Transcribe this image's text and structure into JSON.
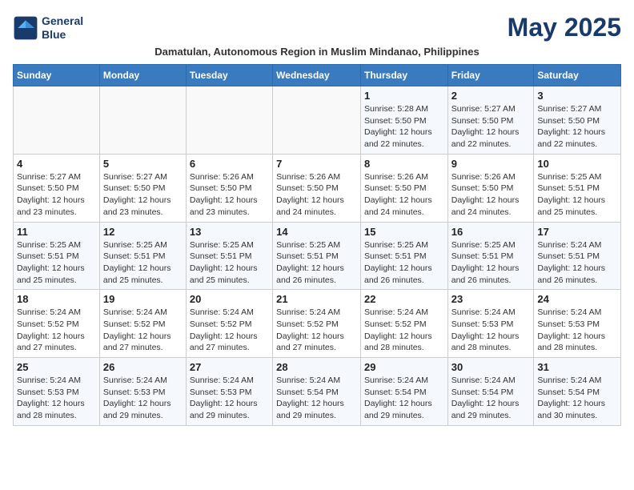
{
  "header": {
    "logo_line1": "General",
    "logo_line2": "Blue",
    "month_title": "May 2025",
    "subtitle": "Damatulan, Autonomous Region in Muslim Mindanao, Philippines"
  },
  "weekdays": [
    "Sunday",
    "Monday",
    "Tuesday",
    "Wednesday",
    "Thursday",
    "Friday",
    "Saturday"
  ],
  "weeks": [
    [
      {
        "day": "",
        "info": ""
      },
      {
        "day": "",
        "info": ""
      },
      {
        "day": "",
        "info": ""
      },
      {
        "day": "",
        "info": ""
      },
      {
        "day": "1",
        "info": "Sunrise: 5:28 AM\nSunset: 5:50 PM\nDaylight: 12 hours and 22 minutes."
      },
      {
        "day": "2",
        "info": "Sunrise: 5:27 AM\nSunset: 5:50 PM\nDaylight: 12 hours and 22 minutes."
      },
      {
        "day": "3",
        "info": "Sunrise: 5:27 AM\nSunset: 5:50 PM\nDaylight: 12 hours and 22 minutes."
      }
    ],
    [
      {
        "day": "4",
        "info": "Sunrise: 5:27 AM\nSunset: 5:50 PM\nDaylight: 12 hours and 23 minutes."
      },
      {
        "day": "5",
        "info": "Sunrise: 5:27 AM\nSunset: 5:50 PM\nDaylight: 12 hours and 23 minutes."
      },
      {
        "day": "6",
        "info": "Sunrise: 5:26 AM\nSunset: 5:50 PM\nDaylight: 12 hours and 23 minutes."
      },
      {
        "day": "7",
        "info": "Sunrise: 5:26 AM\nSunset: 5:50 PM\nDaylight: 12 hours and 24 minutes."
      },
      {
        "day": "8",
        "info": "Sunrise: 5:26 AM\nSunset: 5:50 PM\nDaylight: 12 hours and 24 minutes."
      },
      {
        "day": "9",
        "info": "Sunrise: 5:26 AM\nSunset: 5:50 PM\nDaylight: 12 hours and 24 minutes."
      },
      {
        "day": "10",
        "info": "Sunrise: 5:25 AM\nSunset: 5:51 PM\nDaylight: 12 hours and 25 minutes."
      }
    ],
    [
      {
        "day": "11",
        "info": "Sunrise: 5:25 AM\nSunset: 5:51 PM\nDaylight: 12 hours and 25 minutes."
      },
      {
        "day": "12",
        "info": "Sunrise: 5:25 AM\nSunset: 5:51 PM\nDaylight: 12 hours and 25 minutes."
      },
      {
        "day": "13",
        "info": "Sunrise: 5:25 AM\nSunset: 5:51 PM\nDaylight: 12 hours and 25 minutes."
      },
      {
        "day": "14",
        "info": "Sunrise: 5:25 AM\nSunset: 5:51 PM\nDaylight: 12 hours and 26 minutes."
      },
      {
        "day": "15",
        "info": "Sunrise: 5:25 AM\nSunset: 5:51 PM\nDaylight: 12 hours and 26 minutes."
      },
      {
        "day": "16",
        "info": "Sunrise: 5:25 AM\nSunset: 5:51 PM\nDaylight: 12 hours and 26 minutes."
      },
      {
        "day": "17",
        "info": "Sunrise: 5:24 AM\nSunset: 5:51 PM\nDaylight: 12 hours and 26 minutes."
      }
    ],
    [
      {
        "day": "18",
        "info": "Sunrise: 5:24 AM\nSunset: 5:52 PM\nDaylight: 12 hours and 27 minutes."
      },
      {
        "day": "19",
        "info": "Sunrise: 5:24 AM\nSunset: 5:52 PM\nDaylight: 12 hours and 27 minutes."
      },
      {
        "day": "20",
        "info": "Sunrise: 5:24 AM\nSunset: 5:52 PM\nDaylight: 12 hours and 27 minutes."
      },
      {
        "day": "21",
        "info": "Sunrise: 5:24 AM\nSunset: 5:52 PM\nDaylight: 12 hours and 27 minutes."
      },
      {
        "day": "22",
        "info": "Sunrise: 5:24 AM\nSunset: 5:52 PM\nDaylight: 12 hours and 28 minutes."
      },
      {
        "day": "23",
        "info": "Sunrise: 5:24 AM\nSunset: 5:53 PM\nDaylight: 12 hours and 28 minutes."
      },
      {
        "day": "24",
        "info": "Sunrise: 5:24 AM\nSunset: 5:53 PM\nDaylight: 12 hours and 28 minutes."
      }
    ],
    [
      {
        "day": "25",
        "info": "Sunrise: 5:24 AM\nSunset: 5:53 PM\nDaylight: 12 hours and 28 minutes."
      },
      {
        "day": "26",
        "info": "Sunrise: 5:24 AM\nSunset: 5:53 PM\nDaylight: 12 hours and 29 minutes."
      },
      {
        "day": "27",
        "info": "Sunrise: 5:24 AM\nSunset: 5:53 PM\nDaylight: 12 hours and 29 minutes."
      },
      {
        "day": "28",
        "info": "Sunrise: 5:24 AM\nSunset: 5:54 PM\nDaylight: 12 hours and 29 minutes."
      },
      {
        "day": "29",
        "info": "Sunrise: 5:24 AM\nSunset: 5:54 PM\nDaylight: 12 hours and 29 minutes."
      },
      {
        "day": "30",
        "info": "Sunrise: 5:24 AM\nSunset: 5:54 PM\nDaylight: 12 hours and 29 minutes."
      },
      {
        "day": "31",
        "info": "Sunrise: 5:24 AM\nSunset: 5:54 PM\nDaylight: 12 hours and 30 minutes."
      }
    ]
  ]
}
